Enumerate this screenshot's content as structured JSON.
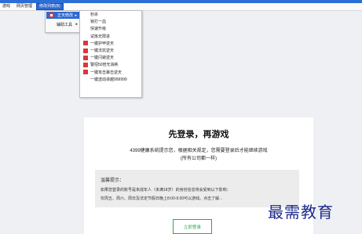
{
  "menubar": {
    "items": [
      {
        "label": "游戏"
      },
      {
        "label": "网页管理"
      },
      {
        "label": "修改列表(B)"
      }
    ]
  },
  "dropdown": {
    "items": [
      {
        "label": "正天修改",
        "icon": "red-square-icon",
        "has_submenu": true
      },
      {
        "label": "辅助工具",
        "icon": "none",
        "has_submenu": true
      }
    ]
  },
  "submenu": {
    "items": [
      {
        "label": "秒杀",
        "icon": "none"
      },
      {
        "label": "锁打一血",
        "icon": "none"
      },
      {
        "label": "快速升级",
        "icon": "none"
      },
      {
        "label": "试炼无限进",
        "icon": "none"
      },
      {
        "label": "一键护甲逆天",
        "icon": "red-square-icon"
      },
      {
        "label": "一键法抗逆天",
        "icon": "red-square-icon"
      },
      {
        "label": "一键闪避逆天",
        "icon": "red-square-icon"
      },
      {
        "label": "警招50倍无消耗",
        "icon": "red-square-icon"
      },
      {
        "label": "一键攻击暴击逆天",
        "icon": "red-square-icon"
      },
      {
        "label": "一键送动卓越999999",
        "icon": "none"
      }
    ]
  },
  "panel": {
    "title": "先登录，再游戏",
    "line1": "4399健康系统提示您，根据相关规定，您需要登录后才能继续游戏",
    "line2": "(所有公司都一样)",
    "notice": {
      "heading": "温馨提示：",
      "line1": "如果您登录的账号是未成年人（未满18岁）的身份信息将会受到以下影响：",
      "line2": "仅周五、周六、周日及法定节假日晚上8:00-9:00可以游戏。点击了解",
      "more": "..."
    },
    "login_button": "立即登录"
  },
  "watermark": "最需教育",
  "colors": {
    "menu_active": "#2e69d1",
    "login_green": "#2fa84f",
    "watermark": "#1d2a8f"
  }
}
